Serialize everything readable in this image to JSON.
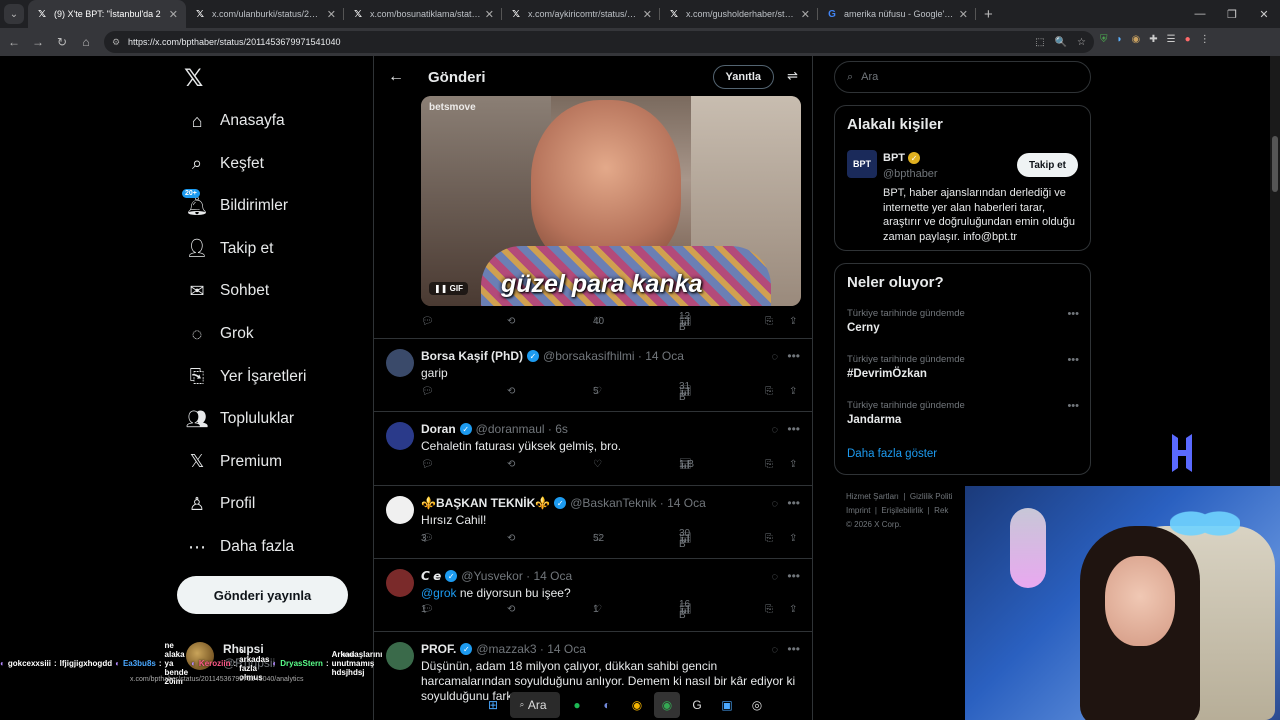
{
  "browser": {
    "tabs": [
      {
        "title": "(9) X'te BPT: \"İstanbul'da 2",
        "icon": "x-logo-icon",
        "active": true
      },
      {
        "title": "x.com/ulanburki/status/20111",
        "icon": "x-logo-icon"
      },
      {
        "title": "x.com/bosunatiklama/status/20",
        "icon": "x-logo-icon"
      },
      {
        "title": "x.com/aykiricomtr/status/20113",
        "icon": "x-logo-icon"
      },
      {
        "title": "x.com/gusholderhaber/status/2",
        "icon": "x-logo-icon"
      },
      {
        "title": "amerika nüfusu - Google'da Ar",
        "icon": "google-icon"
      }
    ],
    "url": "https://x.com/bpthaber/status/2011453679971541040"
  },
  "sidebar": {
    "items": [
      {
        "label": "Anasayfa",
        "icon": "home-icon"
      },
      {
        "label": "Keşfet",
        "icon": "search-icon"
      },
      {
        "label": "Bildirimler",
        "icon": "bell-icon",
        "badge": "20+"
      },
      {
        "label": "Takip et",
        "icon": "follow-icon"
      },
      {
        "label": "Sohbet",
        "icon": "mail-icon"
      },
      {
        "label": "Grok",
        "icon": "grok-icon"
      },
      {
        "label": "Yer İşaretleri",
        "icon": "bookmark-icon"
      },
      {
        "label": "Topluluklar",
        "icon": "communities-icon"
      },
      {
        "label": "Premium",
        "icon": "x-logo-icon"
      },
      {
        "label": "Profil",
        "icon": "profile-icon"
      },
      {
        "label": "Daha fazla",
        "icon": "more-icon"
      }
    ],
    "post_button": "Gönderi yayınla",
    "account": {
      "name": "Rhupsi",
      "handle": "@Rhupsii"
    }
  },
  "feed": {
    "title": "Gönderi",
    "reply_button": "Yanıtla",
    "gif": {
      "brand": "betsmove",
      "caption": "güzel para kanka",
      "badge": "GIF"
    },
    "gif_actions": {
      "likes": "40",
      "views": "12 B"
    },
    "tweets": [
      {
        "name": "Borsa Kaşif (PhD)",
        "handle": "@borsakasifhilmi",
        "date": "· 14 Oca",
        "text": "garip",
        "replies": "",
        "likes": "5",
        "views": "31 B",
        "avatar_color": "#3a4a6a"
      },
      {
        "name": "Doran",
        "handle": "@doranmaul",
        "date": "· 6s",
        "text": "Cehaletin faturası yüksek gelmiş, bro.",
        "replies": "",
        "likes": "",
        "views": "1 B",
        "avatar_color": "#2a3a8a"
      },
      {
        "name": "⚜️BAŞKAN TEKNİK⚜️",
        "handle": "@BaskanTeknik",
        "date": "· 14 Oca",
        "text": "Hırsız Cahil!",
        "replies": "3",
        "likes": "52",
        "views": "30 B",
        "avatar_color": "#f0f0f0"
      },
      {
        "name": "𝘾 𝙚",
        "handle": "@Yusvekor",
        "date": "· 14 Oca",
        "text_link": "@grok",
        "text": "ne diyorsun bu işee?",
        "replies": "1",
        "likes": "1",
        "views": "16 B",
        "avatar_color": "#7a2a2a"
      },
      {
        "name": "PROF.",
        "handle": "@mazzak3",
        "date": "· 14 Oca",
        "text": "Düşünün, adam 18 milyon çalıyor, dükkan sahibi gencin harcamalarından soyulduğunu anlıyor. Demem ki nasıl bir kâr ediyor ki soyulduğunu fark",
        "replies": "",
        "likes": "",
        "views": "",
        "avatar_color": "#3a6a4a"
      }
    ]
  },
  "right": {
    "search_placeholder": "Ara",
    "related_title": "Alakalı kişiler",
    "bpt": {
      "name": "BPT",
      "handle": "@bpthaber",
      "avatar_text": "BPT",
      "bio": "BPT, haber ajanslarından derlediği ve internette yer alan haberleri tarar, araştırır ve doğruluğundan emin olduğu zaman paylaşır. info@bpt.tr",
      "follow": "Takip et"
    },
    "trends_title": "Neler oluyor?",
    "trends": [
      {
        "category": "Türkiye tarihinde gündemde",
        "name": "Cerny"
      },
      {
        "category": "Türkiye tarihinde gündemde",
        "name": "#DevrimÖzkan"
      },
      {
        "category": "Türkiye tarihinde gündemde",
        "name": "Jandarma"
      }
    ],
    "show_more": "Daha fazla göster",
    "footer": [
      "Hizmet Şartları",
      "Gizlilik Politi",
      "Imprint",
      "Erişilebilirlik",
      "Rek",
      "© 2026 X Corp."
    ]
  },
  "chat": [
    {
      "user": "gokcexxsiii",
      "msg": "lfjigjigxhogdd",
      "color": "#ffffff"
    },
    {
      "user": "Ea3bu8s",
      "msg": "ne alaka ya bende 20im",
      "color": "#4aa8ff"
    },
    {
      "user": "Keroziin",
      "msg": "6 arkadas fazla olmus",
      "color": "#ff5a8a"
    },
    {
      "user": "DryasStern",
      "msg": "Arkadaşlarını unutmamış hdsjhdsj",
      "color": "#5aff8a"
    }
  ],
  "status_url": "x.com/bpthaber/status/2011453679971541040/analytics",
  "taskbar_search": "Ara"
}
